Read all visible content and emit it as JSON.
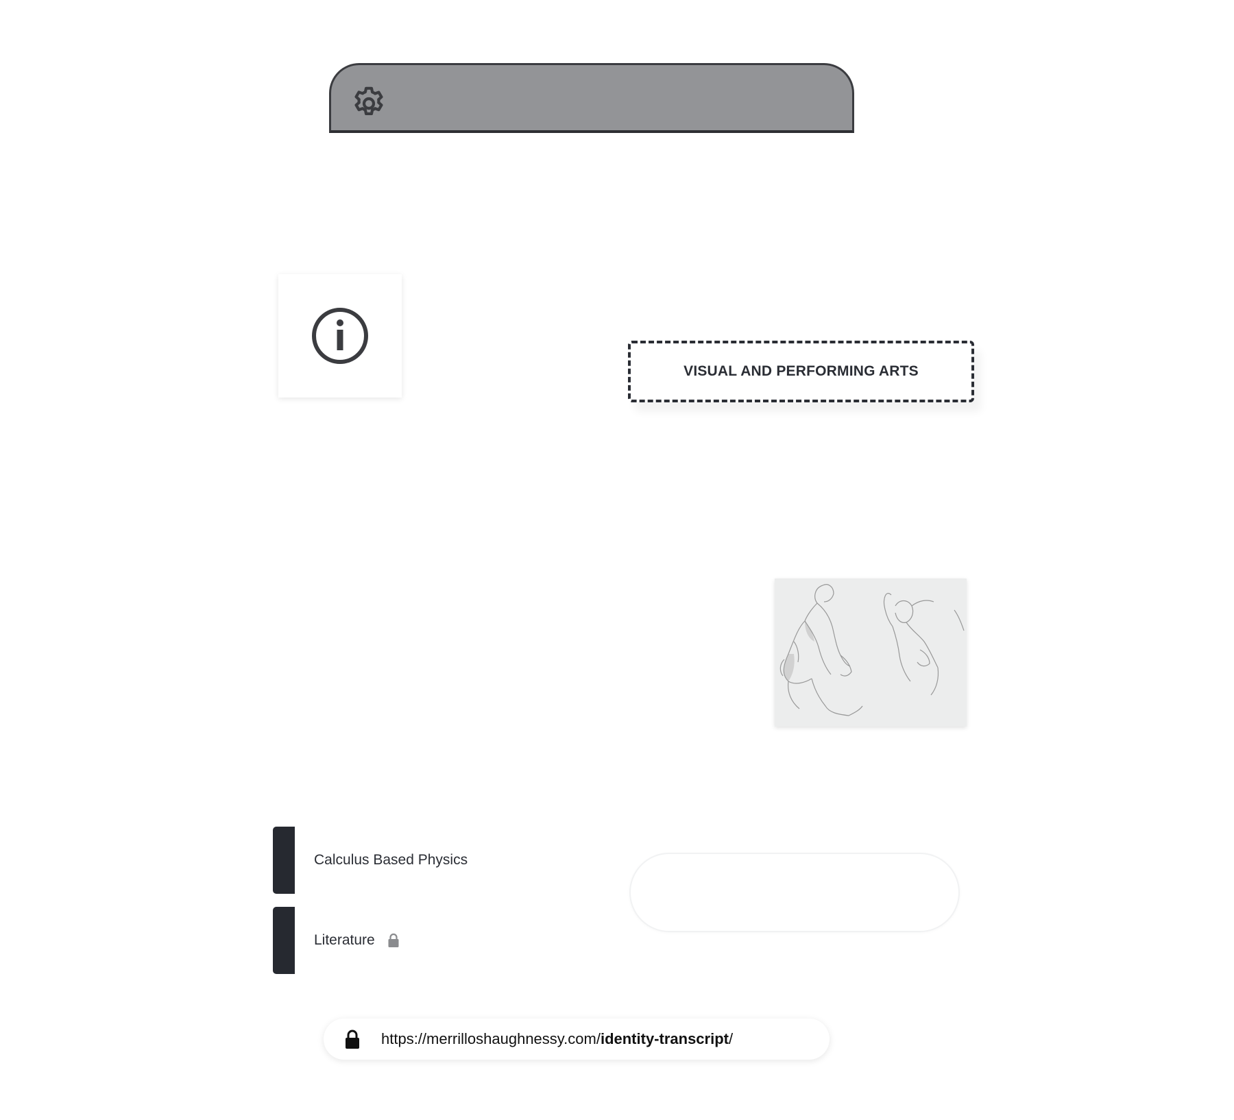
{
  "top_bar": {
    "icon": "gear-icon"
  },
  "info_card": {
    "icon": "info-icon"
  },
  "category": {
    "label": "VISUAL AND PERFORMING ARTS"
  },
  "image": {
    "subject": "sketch-image"
  },
  "courses": [
    {
      "label": "Calculus Based Physics",
      "locked": false
    },
    {
      "label": "Literature",
      "locked": true
    }
  ],
  "url_bar": {
    "domain": "https://merrilloshaughnessy.com/",
    "path": "identity-transcript",
    "suffix": "/"
  },
  "colors": {
    "top_bar_bg": "#939497",
    "dark": "#262930",
    "text": "#2a2d34"
  }
}
